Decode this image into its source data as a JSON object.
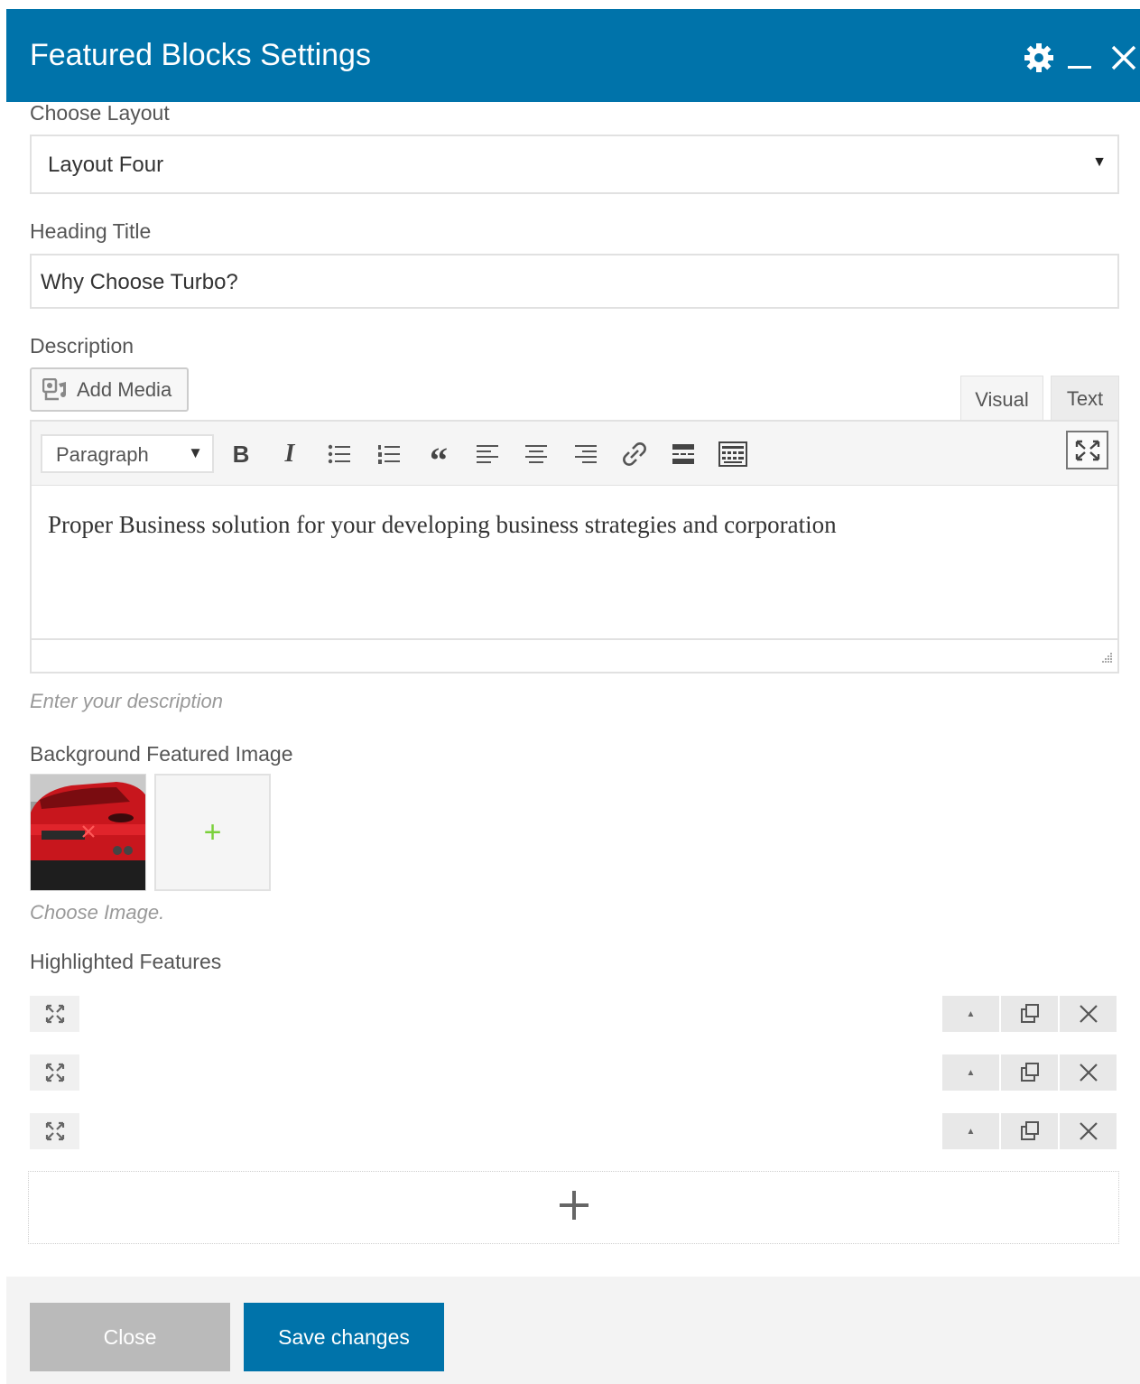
{
  "dialog": {
    "title": "Featured Blocks Settings",
    "icons": [
      "gear-icon",
      "minimize-icon",
      "close-icon"
    ]
  },
  "layout": {
    "label": "Choose Layout",
    "value": "Layout Four"
  },
  "heading": {
    "label": "Heading Title",
    "value": "Why Choose Turbo?"
  },
  "description": {
    "label": "Description",
    "add_media": "Add Media",
    "tabs": {
      "visual": "Visual",
      "text": "Text"
    },
    "format": "Paragraph",
    "toolbar_icons": [
      "bold-icon",
      "italic-icon",
      "bullet-list-icon",
      "numbered-list-icon",
      "blockquote-icon",
      "align-left-icon",
      "align-center-icon",
      "align-right-icon",
      "link-icon",
      "read-more-icon",
      "toolbar-toggle-icon",
      "fullscreen-icon"
    ],
    "content": "Proper Business solution for your developing business strategies and corporation",
    "hint": "Enter your description"
  },
  "background": {
    "label": "Background Featured Image",
    "hint": "Choose Image.",
    "add_symbol": "+"
  },
  "features": {
    "label": "Highlighted Features",
    "item_count": 3,
    "add_symbol": "+"
  },
  "footer": {
    "close": "Close",
    "save": "Save changes"
  },
  "colors": {
    "primary": "#0073aa",
    "close_button": "#bababa",
    "add_image_plus": "#7ad03a"
  }
}
